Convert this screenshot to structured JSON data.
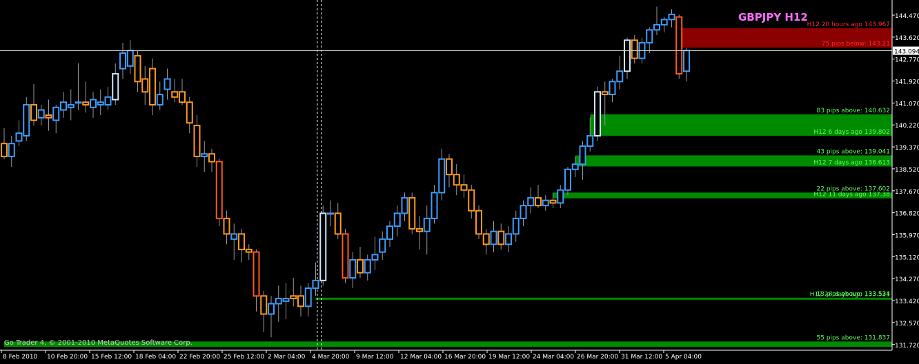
{
  "chart_data": {
    "type": "candlestick",
    "title": "GBPJPY H12",
    "copyright": "Go Trader 4, © 2001-2010 MetaQuotes Software Corp.",
    "current_price": "143.094",
    "ylim": [
      131.5,
      144.95
    ],
    "y_ticks": [
      "144.470",
      "143.620",
      "142.770",
      "141.920",
      "141.070",
      "140.220",
      "139.370",
      "138.520",
      "137.670",
      "136.820",
      "135.970",
      "135.120",
      "134.270",
      "133.420",
      "132.570",
      "131.720"
    ],
    "x_ticks": [
      "8 Feb 2010",
      "10 Feb 20:00",
      "15 Feb 12:00",
      "18 Feb 04:00",
      "22 Feb 20:00",
      "25 Feb 12:00",
      "2 Mar 04:00",
      "4 Mar 20:00",
      "9 Mar 12:00",
      "12 Mar 04:00",
      "16 Mar 20:00",
      "19 Mar 12:00",
      "24 Mar 04:00",
      "26 Mar 20:00",
      "31 Mar 12:00",
      "5 Apr 04:00"
    ],
    "candles": [
      {
        "o": 139.5,
        "h": 140.1,
        "l": 138.9,
        "c": 139.0
      },
      {
        "o": 139.0,
        "h": 139.8,
        "l": 138.6,
        "c": 139.5
      },
      {
        "o": 139.6,
        "h": 140.4,
        "l": 139.4,
        "c": 139.9
      },
      {
        "o": 139.8,
        "h": 141.3,
        "l": 139.6,
        "c": 141.0
      },
      {
        "o": 141.0,
        "h": 141.8,
        "l": 140.2,
        "c": 140.4
      },
      {
        "o": 140.5,
        "h": 141.0,
        "l": 140.2,
        "c": 140.8
      },
      {
        "o": 140.6,
        "h": 141.2,
        "l": 140.0,
        "c": 140.5
      },
      {
        "o": 140.4,
        "h": 141.0,
        "l": 139.9,
        "c": 140.9
      },
      {
        "o": 140.8,
        "h": 141.5,
        "l": 140.5,
        "c": 141.1
      },
      {
        "o": 140.9,
        "h": 141.6,
        "l": 140.4,
        "c": 141.0
      },
      {
        "o": 141.1,
        "h": 142.6,
        "l": 140.8,
        "c": 141.1
      },
      {
        "o": 141.1,
        "h": 141.9,
        "l": 140.7,
        "c": 141.0
      },
      {
        "o": 140.9,
        "h": 141.5,
        "l": 140.5,
        "c": 141.2
      },
      {
        "o": 141.0,
        "h": 141.6,
        "l": 140.6,
        "c": 141.1
      },
      {
        "o": 141.0,
        "h": 141.7,
        "l": 140.8,
        "c": 141.3
      },
      {
        "o": 141.2,
        "h": 142.6,
        "l": 141.0,
        "c": 142.2
      },
      {
        "o": 142.4,
        "h": 143.4,
        "l": 142.0,
        "c": 143.0
      },
      {
        "o": 142.5,
        "h": 143.5,
        "l": 142.2,
        "c": 143.1
      },
      {
        "o": 142.9,
        "h": 143.1,
        "l": 141.5,
        "c": 141.9
      },
      {
        "o": 142.0,
        "h": 142.5,
        "l": 141.0,
        "c": 141.5
      },
      {
        "o": 142.4,
        "h": 142.8,
        "l": 140.6,
        "c": 141.0
      },
      {
        "o": 141.0,
        "h": 141.9,
        "l": 140.8,
        "c": 141.4
      },
      {
        "o": 141.6,
        "h": 142.4,
        "l": 141.2,
        "c": 142.0
      },
      {
        "o": 141.5,
        "h": 142.0,
        "l": 141.1,
        "c": 141.3
      },
      {
        "o": 141.5,
        "h": 142.0,
        "l": 141.0,
        "c": 141.1
      },
      {
        "o": 141.1,
        "h": 141.3,
        "l": 139.9,
        "c": 140.3
      },
      {
        "o": 140.2,
        "h": 140.6,
        "l": 138.6,
        "c": 139.0
      },
      {
        "o": 139.0,
        "h": 139.6,
        "l": 138.4,
        "c": 139.1
      },
      {
        "o": 139.1,
        "h": 139.3,
        "l": 138.4,
        "c": 138.8
      },
      {
        "o": 138.8,
        "h": 138.9,
        "l": 136.3,
        "c": 136.6
      },
      {
        "o": 136.6,
        "h": 136.9,
        "l": 135.6,
        "c": 136.0
      },
      {
        "o": 135.8,
        "h": 136.4,
        "l": 135.0,
        "c": 136.0
      },
      {
        "o": 136.0,
        "h": 136.2,
        "l": 134.9,
        "c": 135.4
      },
      {
        "o": 135.4,
        "h": 135.6,
        "l": 135.0,
        "c": 135.3
      },
      {
        "o": 135.3,
        "h": 135.4,
        "l": 133.0,
        "c": 133.6
      },
      {
        "o": 133.6,
        "h": 133.8,
        "l": 132.2,
        "c": 132.9
      },
      {
        "o": 132.9,
        "h": 133.6,
        "l": 132.0,
        "c": 133.3
      },
      {
        "o": 133.3,
        "h": 134.0,
        "l": 132.6,
        "c": 133.5
      },
      {
        "o": 133.4,
        "h": 134.1,
        "l": 132.7,
        "c": 133.5
      },
      {
        "o": 133.6,
        "h": 134.3,
        "l": 133.2,
        "c": 133.5
      },
      {
        "o": 133.6,
        "h": 134.0,
        "l": 132.8,
        "c": 133.2
      },
      {
        "o": 133.2,
        "h": 134.1,
        "l": 132.8,
        "c": 133.9
      },
      {
        "o": 133.9,
        "h": 134.9,
        "l": 133.6,
        "c": 134.2
      },
      {
        "o": 134.2,
        "h": 137.1,
        "l": 134.0,
        "c": 136.8
      },
      {
        "o": 136.8,
        "h": 137.3,
        "l": 136.3,
        "c": 136.8
      },
      {
        "o": 136.8,
        "h": 137.2,
        "l": 135.8,
        "c": 136.0
      },
      {
        "o": 136.0,
        "h": 136.2,
        "l": 134.1,
        "c": 134.3
      },
      {
        "o": 134.3,
        "h": 135.3,
        "l": 133.9,
        "c": 135.0
      },
      {
        "o": 135.0,
        "h": 135.5,
        "l": 134.3,
        "c": 134.5
      },
      {
        "o": 134.5,
        "h": 135.2,
        "l": 134.2,
        "c": 135.0
      },
      {
        "o": 135.0,
        "h": 135.9,
        "l": 134.6,
        "c": 135.2
      },
      {
        "o": 135.3,
        "h": 136.1,
        "l": 135.0,
        "c": 135.8
      },
      {
        "o": 135.8,
        "h": 136.5,
        "l": 135.5,
        "c": 136.3
      },
      {
        "o": 136.3,
        "h": 137.1,
        "l": 135.9,
        "c": 136.8
      },
      {
        "o": 136.8,
        "h": 137.6,
        "l": 136.5,
        "c": 137.4
      },
      {
        "o": 137.4,
        "h": 137.6,
        "l": 136.0,
        "c": 136.2
      },
      {
        "o": 136.2,
        "h": 136.7,
        "l": 135.4,
        "c": 136.1
      },
      {
        "o": 136.1,
        "h": 137.1,
        "l": 135.2,
        "c": 136.6
      },
      {
        "o": 136.6,
        "h": 137.9,
        "l": 136.4,
        "c": 137.6
      },
      {
        "o": 137.6,
        "h": 139.3,
        "l": 137.3,
        "c": 138.9
      },
      {
        "o": 138.9,
        "h": 139.1,
        "l": 137.8,
        "c": 138.3
      },
      {
        "o": 138.3,
        "h": 138.7,
        "l": 137.5,
        "c": 137.9
      },
      {
        "o": 137.9,
        "h": 138.3,
        "l": 137.4,
        "c": 137.7
      },
      {
        "o": 137.7,
        "h": 137.9,
        "l": 136.6,
        "c": 136.9
      },
      {
        "o": 136.9,
        "h": 137.1,
        "l": 135.8,
        "c": 136.0
      },
      {
        "o": 136.0,
        "h": 136.2,
        "l": 135.2,
        "c": 135.6
      },
      {
        "o": 135.6,
        "h": 136.5,
        "l": 135.3,
        "c": 136.1
      },
      {
        "o": 136.1,
        "h": 136.4,
        "l": 135.4,
        "c": 135.6
      },
      {
        "o": 135.6,
        "h": 136.3,
        "l": 135.3,
        "c": 136.0
      },
      {
        "o": 136.0,
        "h": 136.9,
        "l": 135.7,
        "c": 136.6
      },
      {
        "o": 136.6,
        "h": 137.3,
        "l": 136.3,
        "c": 137.1
      },
      {
        "o": 137.1,
        "h": 137.8,
        "l": 136.8,
        "c": 137.4
      },
      {
        "o": 137.4,
        "h": 137.9,
        "l": 137.0,
        "c": 137.1
      },
      {
        "o": 137.1,
        "h": 137.5,
        "l": 136.9,
        "c": 137.3
      },
      {
        "o": 137.3,
        "h": 137.6,
        "l": 137.0,
        "c": 137.2
      },
      {
        "o": 137.2,
        "h": 137.9,
        "l": 137.0,
        "c": 137.7
      },
      {
        "o": 137.7,
        "h": 138.6,
        "l": 137.5,
        "c": 138.5
      },
      {
        "o": 138.5,
        "h": 139.0,
        "l": 138.2,
        "c": 138.7
      },
      {
        "o": 138.7,
        "h": 139.6,
        "l": 138.1,
        "c": 139.4
      },
      {
        "o": 139.4,
        "h": 140.5,
        "l": 139.2,
        "c": 139.8
      },
      {
        "o": 139.8,
        "h": 141.7,
        "l": 139.6,
        "c": 141.5
      },
      {
        "o": 141.5,
        "h": 141.9,
        "l": 140.2,
        "c": 141.4
      },
      {
        "o": 141.4,
        "h": 142.0,
        "l": 141.1,
        "c": 141.9
      },
      {
        "o": 141.9,
        "h": 142.9,
        "l": 141.6,
        "c": 142.3
      },
      {
        "o": 142.3,
        "h": 143.6,
        "l": 142.0,
        "c": 143.5
      },
      {
        "o": 143.5,
        "h": 143.7,
        "l": 142.6,
        "c": 142.8
      },
      {
        "o": 142.8,
        "h": 143.6,
        "l": 142.6,
        "c": 143.4
      },
      {
        "o": 143.4,
        "h": 144.0,
        "l": 143.0,
        "c": 143.9
      },
      {
        "o": 143.9,
        "h": 144.8,
        "l": 143.7,
        "c": 144.1
      },
      {
        "o": 144.1,
        "h": 144.4,
        "l": 143.8,
        "c": 144.3
      },
      {
        "o": 144.3,
        "h": 144.7,
        "l": 144.0,
        "c": 144.5
      },
      {
        "o": 144.4,
        "h": 144.5,
        "l": 142.0,
        "c": 142.2
      },
      {
        "o": 142.3,
        "h": 143.2,
        "l": 141.9,
        "c": 143.1
      }
    ],
    "zones": [
      {
        "top": 143.967,
        "bottom": 143.21,
        "color": "#8b0000",
        "top_label": "H12 20 hours ago 143.967",
        "bottom_label": "75 pips below: 143.21",
        "label_color": "#ff2a2a",
        "start": 91
      },
      {
        "top": 140.632,
        "bottom": 139.802,
        "color": "#008a00",
        "top_label": "83 pips above: 140.632",
        "bottom_label": "H12 6 days ago 139.802",
        "label_color": "#5cff5c",
        "start": 79
      },
      {
        "top": 139.041,
        "bottom": 138.613,
        "color": "#008a00",
        "top_label": "43 pips above: 139.041",
        "bottom_label": "H12 7 days ago 138.613",
        "label_color": "#5cff5c",
        "start": 77
      },
      {
        "top": 137.602,
        "bottom": 137.38,
        "color": "#008a00",
        "top_label": "22 pips above: 137.602",
        "bottom_label": "H12 11 days ago 137.38",
        "label_color": "#5cff5c",
        "start": 74
      },
      {
        "top": 133.534,
        "bottom": 133.521,
        "color": "#008a00",
        "top_label": "13 pips above: 133.534",
        "bottom_label": "H12 28 days ago 133.521",
        "label_color": "#5cff5c",
        "start": 42
      },
      {
        "top": 131.837,
        "bottom": 131.63,
        "color": "#008a00",
        "top_label": "55 pips above: 131.837",
        "bottom_label": "",
        "label_color": "#5cff5c",
        "start": 0
      }
    ],
    "colors": {
      "bull": "#3d9cff",
      "bear": "#ff9a1a",
      "bull_strong": "#cfe6ff",
      "bear_strong": "#ff5a1a",
      "title": "#ff6cff",
      "axis_text": "#ffffff",
      "separator": "#ffffff"
    },
    "strong_bull_index": [
      15,
      43,
      80,
      84
    ],
    "strong_bear_index": [
      29,
      34,
      46,
      91
    ],
    "separator_index": 42.5
  }
}
